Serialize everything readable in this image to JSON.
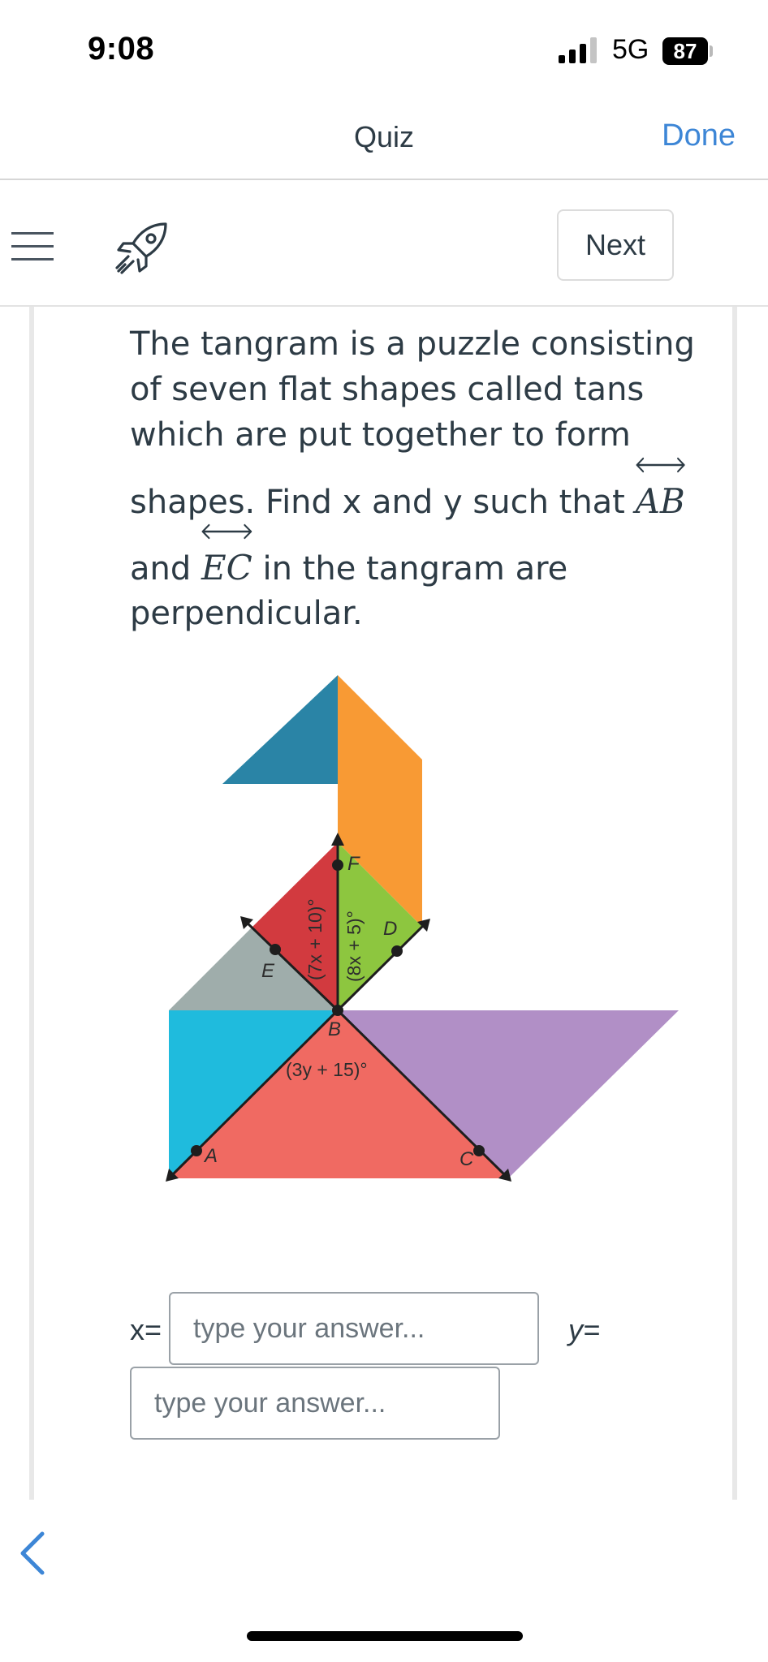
{
  "status_bar": {
    "time": "9:08",
    "network": "5G",
    "battery": "87"
  },
  "nav": {
    "title": "Quiz",
    "done_label": "Done"
  },
  "toolbar": {
    "menu_icon": "hamburger-menu-icon",
    "rocket_icon": "rocket-icon",
    "next_label": "Next"
  },
  "question": {
    "line1": "The tangram is a puzzle consisting",
    "line2": "of seven flat shapes called tans",
    "line3": "which are put together to form",
    "line4_pre": "shapes. Find x and y such that ",
    "line4_math": "AB",
    "line5_pre": "and ",
    "line5_math": "EC",
    "line5_post": " in the tangram are",
    "line6": "perpendicular."
  },
  "diagram": {
    "points": {
      "A": "A",
      "B": "B",
      "C": "C",
      "D": "D",
      "E": "E",
      "F": "F"
    },
    "angle_labels": {
      "red_small": "(7x + 10)°",
      "green_small": "(8x + 5)°",
      "bottom": "(3y + 15)°"
    },
    "colors": {
      "dark_blue": "#2a84a6",
      "orange": "#f89a34",
      "gray": "#9fadab",
      "red_small": "#d23a3f",
      "green": "#8dc63f",
      "cyan": "#1fbbdd",
      "purple": "#b18fc6",
      "salmon": "#f06a62"
    }
  },
  "answers": {
    "x_label": "x=",
    "y_label": "y=",
    "x_placeholder": "type your answer...",
    "y_placeholder": "type your answer..."
  },
  "footer": {
    "back_icon": "chevron-left-icon"
  },
  "colors": {
    "accent": "#3d86d6",
    "text": "#2d3b45"
  }
}
